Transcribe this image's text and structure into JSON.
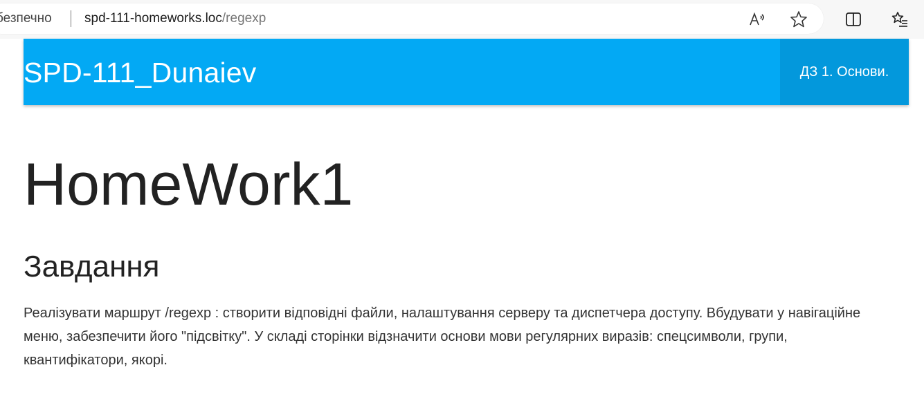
{
  "browser": {
    "security_text": "безпечно",
    "url_host": "spd-111-homeworks.loc",
    "url_path": "/regexp",
    "icons": [
      "read-aloud-icon",
      "favorite-star-icon",
      "split-screen-icon",
      "favorites-list-icon"
    ]
  },
  "navbar": {
    "brand": "SPD-111_Dunaiev",
    "item_label": "ДЗ 1. Основи.",
    "background": "#03a9f4",
    "active_background": "#0398dc"
  },
  "content": {
    "title": "HomeWork1",
    "section_title": "Завдання",
    "description": "Реалізувати маршрут /regexp : створити відповідні файли, налаштування серверу та диспетчера доступу. Вбудувати у навігаційне меню, забезпечити його \"підсвітку\". У складі сторінки відзначити основи мови регулярних виразів: спецсимволи, групи, квантифікатори, якорі."
  }
}
